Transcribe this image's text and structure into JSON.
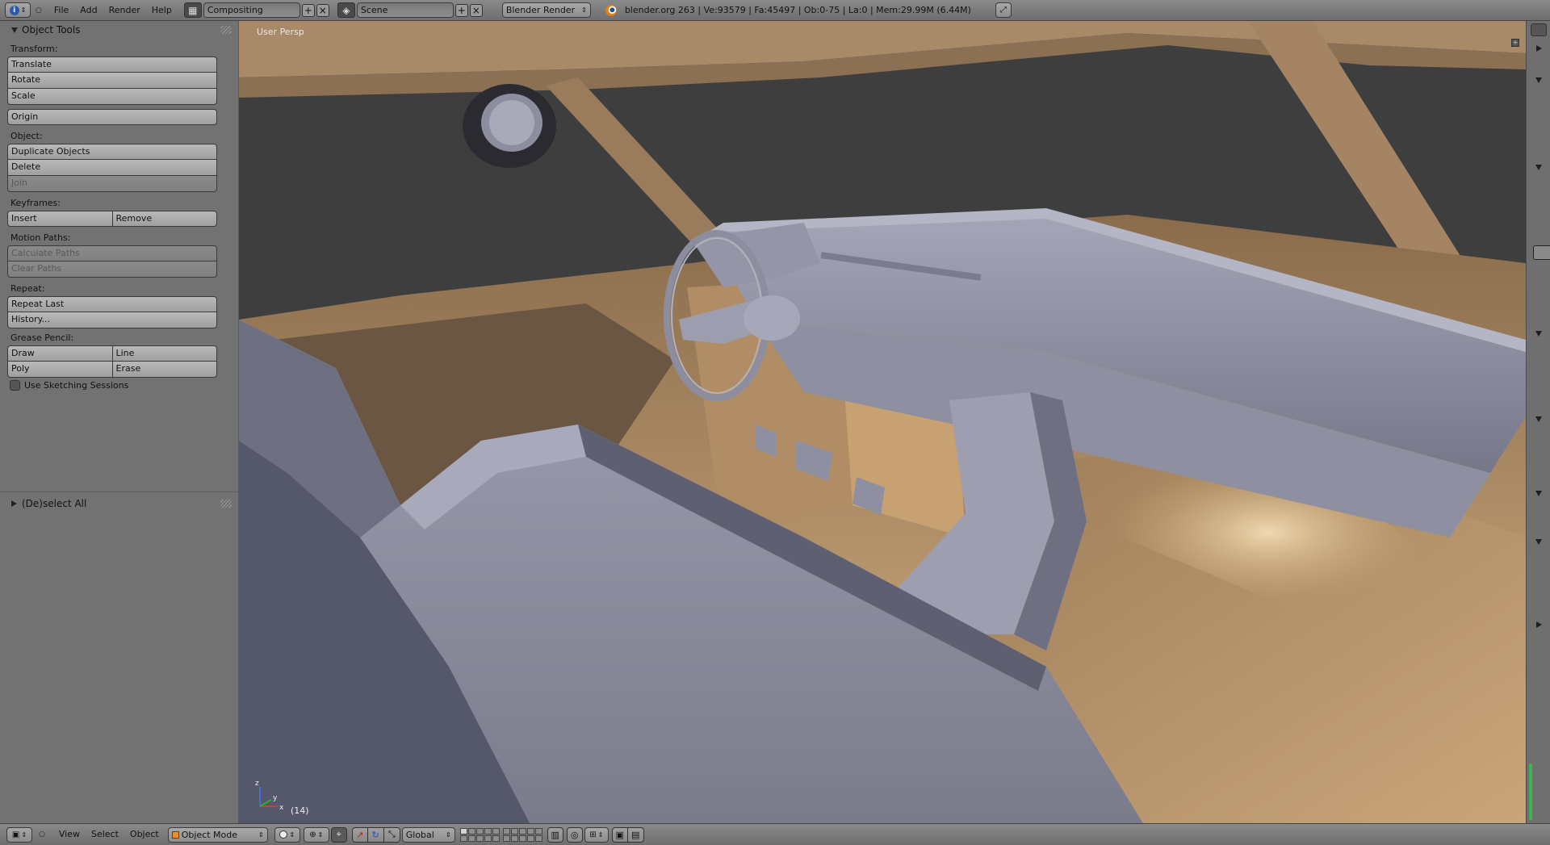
{
  "top_bar": {
    "menus": [
      "File",
      "Add",
      "Render",
      "Help"
    ],
    "screen_layout": "Compositing",
    "scene": "Scene",
    "render_engine": "Blender Render",
    "stats": "blender.org 263 | Ve:93579 | Fa:45497 | Ob:0-75 | La:0 | Mem:29.99M (6.44M)",
    "icons": [
      "info-icon",
      "screen-layout-icon",
      "scene-icon",
      "blender-logo-icon",
      "fullscreen-icon"
    ]
  },
  "tool_shelf": {
    "panel_title": "Object Tools",
    "sections": {
      "transform": {
        "label": "Transform:",
        "buttons": [
          "Translate",
          "Rotate",
          "Scale"
        ]
      },
      "origin": {
        "buttons": [
          "Origin"
        ]
      },
      "object": {
        "label": "Object:",
        "buttons": [
          "Duplicate Objects",
          "Delete",
          "Join"
        ]
      },
      "keyframes": {
        "label": "Keyframes:",
        "buttons": [
          "Insert",
          "Remove"
        ]
      },
      "motion_paths": {
        "label": "Motion Paths:",
        "buttons": [
          "Calculate Paths",
          "Clear Paths"
        ]
      },
      "repeat": {
        "label": "Repeat:",
        "buttons": [
          "Repeat Last",
          "History..."
        ]
      },
      "grease_pencil": {
        "label": "Grease Pencil:",
        "buttons": [
          "Draw",
          "Line",
          "Poly",
          "Erase"
        ],
        "checkbox": "Use Sketching Sessions",
        "checkbox_checked": false
      }
    },
    "operator_panel_title": "(De)select All"
  },
  "viewport": {
    "view_label": "User Persp",
    "frame": "(14)",
    "axis_labels": [
      "x",
      "y",
      "z"
    ]
  },
  "bottom_bar": {
    "menus": [
      "View",
      "Select",
      "Object"
    ],
    "mode": "Object Mode",
    "transform_orientation": "Global"
  },
  "colors": {
    "header_bg": "#7c7c7c",
    "panel_bg": "#727272",
    "viewport_bg": "#3d3d3d",
    "text_light": "#e8e8e8",
    "car_interior_tan": "#b8946a",
    "mesh_grey": "#8a8c9e"
  }
}
